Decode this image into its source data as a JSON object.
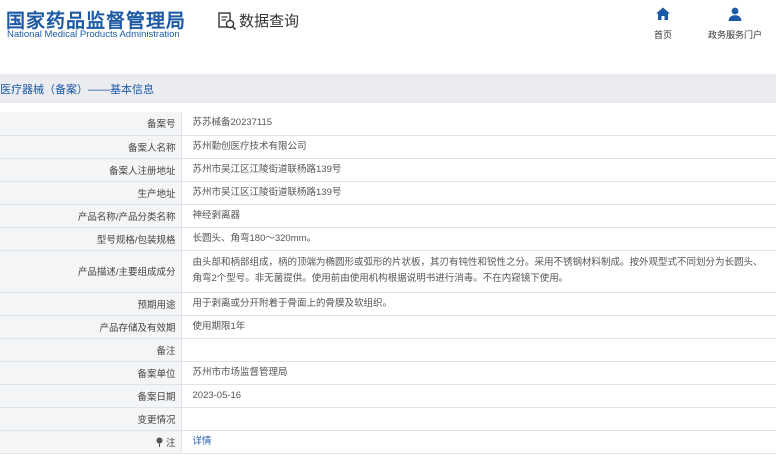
{
  "header": {
    "logo_cn": "国家药品监督管理局",
    "logo_en": "National Medical Products Administration",
    "query_label": "数据查询",
    "query_icon": "data-query-icon",
    "nav": [
      {
        "label": "首页",
        "icon": "home-icon"
      },
      {
        "label": "政务服务门户",
        "icon": "user-icon"
      }
    ]
  },
  "section_title": "医疗器械（备案）——基本信息",
  "rows": [
    {
      "label": "备案号",
      "value": "苏苏械备20237115"
    },
    {
      "label": "备案人名称",
      "value": "苏州勤创医疗技术有限公司"
    },
    {
      "label": "备案人注册地址",
      "value": "苏州市吴江区江陵街道联杨路139号"
    },
    {
      "label": "生产地址",
      "value": "苏州市吴江区江陵街道联杨路139号"
    },
    {
      "label": "产品名称/产品分类名称",
      "value": "神经剥离器"
    },
    {
      "label": "型号规格/包装规格",
      "value": "长圆头、角弯180～320mm。"
    },
    {
      "label": "产品描述/主要组成成分",
      "value": "由头部和柄部组成，柄的顶端为椭圆形或弧形的片状板，其刃有钝性和锐性之分。采用不锈钢材料制成。按外观型式不同划分为长圆头、角弯2个型号。非无菌提供。使用前由使用机构根据说明书进行消毒。不在内窥镜下使用。"
    },
    {
      "label": "预期用途",
      "value": "用于剥离或分开附着于骨面上的骨膜及软组织。"
    },
    {
      "label": "产品存储及有效期",
      "value": "使用期限1年"
    },
    {
      "label": "备注",
      "value": ""
    },
    {
      "label": "备案单位",
      "value": "苏州市市场监督管理局"
    },
    {
      "label": "备案日期",
      "value": "2023-05-16"
    },
    {
      "label": "变更情况",
      "value": ""
    },
    {
      "label": "注",
      "value": "详情",
      "icon": "pin-icon"
    }
  ]
}
